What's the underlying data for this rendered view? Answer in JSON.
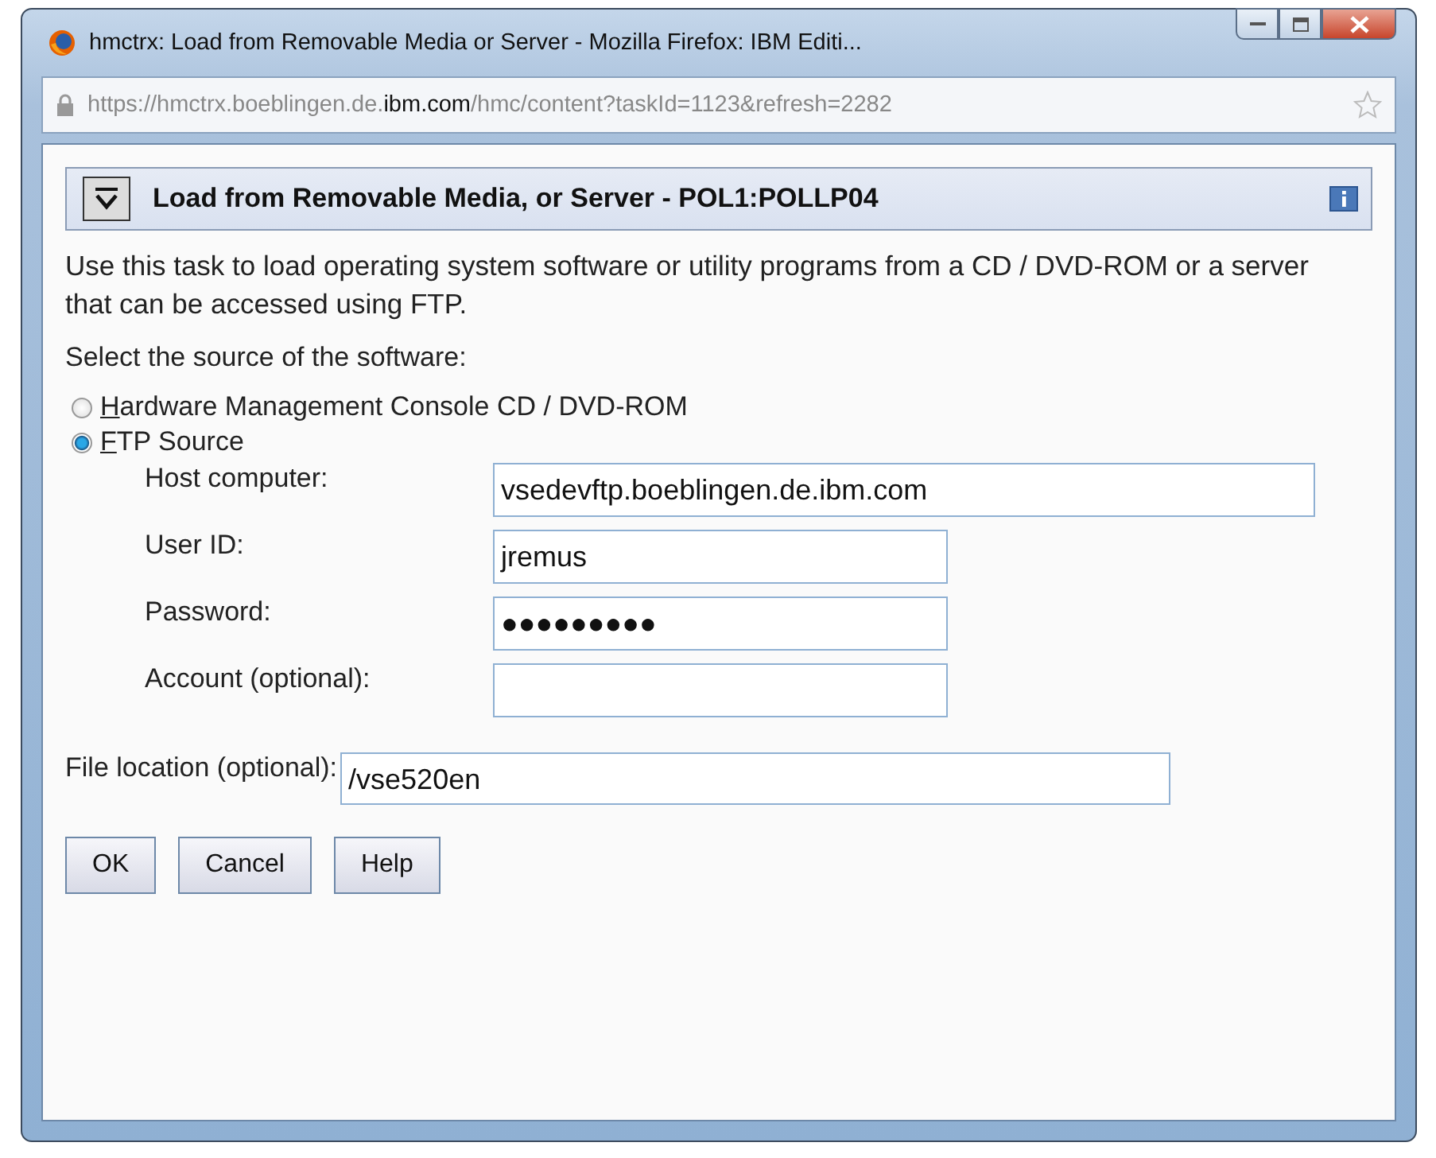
{
  "window": {
    "title": "hmctrx: Load from Removable Media or Server - Mozilla Firefox: IBM Editi..."
  },
  "address_bar": {
    "prefix": "https://hmctrx.boeblingen.de.",
    "domain": "ibm.com",
    "path": "/hmc/content?taskId=1123&refresh=2282"
  },
  "panel": {
    "title": "Load from Removable Media, or Server - POL1:POLLP04"
  },
  "description": "Use this task to load operating system software or utility programs from a CD / DVD-ROM or a server that can be accessed using FTP.",
  "source_prompt": "Select the source of the software:",
  "sources": [
    {
      "mnemonic": "H",
      "label_rest": "ardware Management Console CD / DVD-ROM",
      "selected": false
    },
    {
      "mnemonic": "F",
      "label_rest": "TP Source",
      "selected": true
    }
  ],
  "ftp_fields": [
    {
      "label": "Host computer:",
      "value": "vsedevftp.boeblingen.de.ibm.com",
      "kind": "wide"
    },
    {
      "label": "User ID:",
      "value": "jremus",
      "kind": "narrow"
    },
    {
      "label": "Password:",
      "value": "●●●●●●●●●",
      "kind": "narrow"
    },
    {
      "label": "Account (optional):",
      "kind": "narrow"
    }
  ],
  "file_location": {
    "label": "File location (optional):",
    "value": "/vse520en"
  },
  "buttons": [
    "OK",
    "Cancel",
    "Help"
  ]
}
